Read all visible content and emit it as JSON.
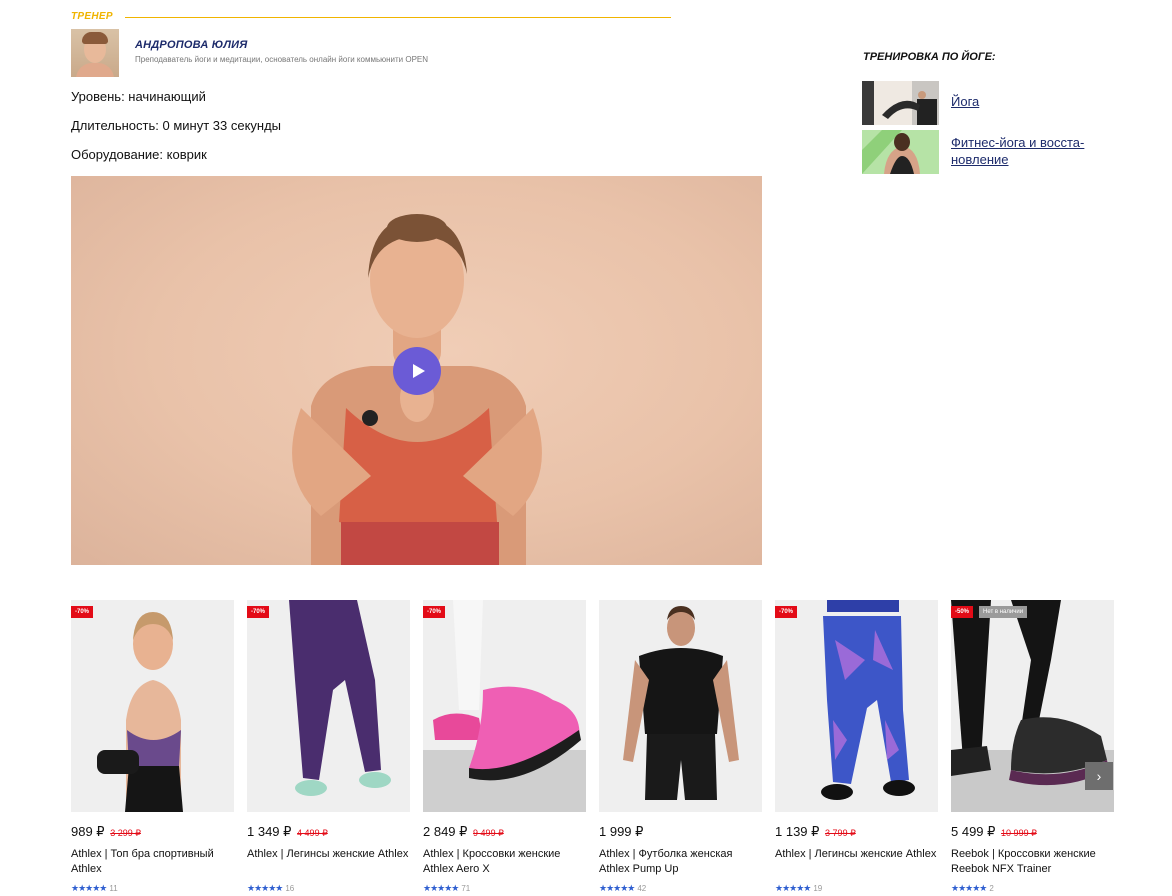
{
  "trainer": {
    "section_label": "ТРЕНЕР",
    "name": "АНДРОПОВА ЮЛИЯ",
    "description": "Преподаватель йоги и медитации, основатель онлайн йоги коммьюнити OPEN"
  },
  "details": {
    "level": "Уровень: начинающий",
    "duration": "Длительность: 0 минут 33 секунды",
    "equipment": "Оборудование: коврик"
  },
  "video": {
    "state": "paused",
    "play_icon": "play-icon"
  },
  "sidebar": {
    "title": "ТРЕНИРОВКА ПО ЙОГЕ:",
    "items": [
      {
        "label": "Йога"
      },
      {
        "label": "Фитнес-йога и восста-\nновление"
      }
    ]
  },
  "products": [
    {
      "discount": "-70%",
      "price": "989 ₽",
      "old_price": "3 299 ₽",
      "name": "Athlex | Топ бра спортивный Athlex",
      "stars": "★★★★★",
      "reviews": "11"
    },
    {
      "discount": "-70%",
      "price": "1 349 ₽",
      "old_price": "4 499 ₽",
      "name": "Athlex | Легинсы женские Athlex",
      "stars": "★★★★★",
      "reviews": "16"
    },
    {
      "discount": "-70%",
      "price": "2 849 ₽",
      "old_price": "9 499 ₽",
      "name": "Athlex | Кроссовки женские Athlex Aero X",
      "stars": "★★★★★",
      "reviews": "71"
    },
    {
      "discount": "",
      "price": "1 999 ₽",
      "old_price": "",
      "name": "Athlex | Футболка женская Athlex Pump Up",
      "stars": "★★★★★",
      "reviews": "42"
    },
    {
      "discount": "-70%",
      "price": "1 139 ₽",
      "old_price": "3 799 ₽",
      "name": "Athlex | Легинсы женские Athlex",
      "stars": "★★★★★",
      "reviews": "19"
    },
    {
      "discount": "-50%",
      "availability": "Нет в наличии",
      "price": "5 499 ₽",
      "old_price": "10 999 ₽",
      "name": "Reebok | Кроссовки женские Reebok NFX Trainer",
      "stars": "★★★★★",
      "reviews": "2"
    }
  ],
  "carousel": {
    "next_icon": "chevron-right-icon",
    "next_glyph": "›"
  },
  "colors": {
    "accent": "#f0b400",
    "title": "#1d2b6b",
    "discount": "#e30b17",
    "play": "#6b5bd6",
    "stars": "#2f5fd0"
  }
}
